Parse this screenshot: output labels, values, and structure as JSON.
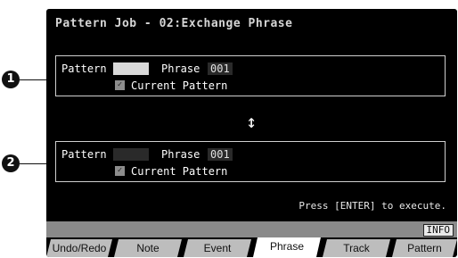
{
  "callouts": [
    "1",
    "2"
  ],
  "title": "Pattern Job - 02:Exchange Phrase",
  "panel1": {
    "pattern_label": "Pattern",
    "pattern_value": "",
    "phrase_label": "Phrase",
    "phrase_value": "001",
    "checkbox_label": "Current Pattern",
    "checkbox_checked": true
  },
  "swap_icon": "updown-arrow-icon",
  "panel2": {
    "pattern_label": "Pattern",
    "pattern_value": "",
    "phrase_label": "Phrase",
    "phrase_value": "001",
    "checkbox_label": "Current Pattern",
    "checkbox_checked": true
  },
  "hint": "Press [ENTER] to execute.",
  "info_button": "INFO",
  "tabs": [
    {
      "label": "Undo/Redo",
      "active": false
    },
    {
      "label": "Note",
      "active": false
    },
    {
      "label": "Event",
      "active": false
    },
    {
      "label": "Phrase",
      "active": true
    },
    {
      "label": "Track",
      "active": false
    },
    {
      "label": "Pattern",
      "active": false
    }
  ],
  "colors": {
    "screen_bg": "#000000",
    "tab_active": "#ffffff",
    "tab_inactive": "#bdbdbd",
    "bar": "#8a8a8a"
  }
}
